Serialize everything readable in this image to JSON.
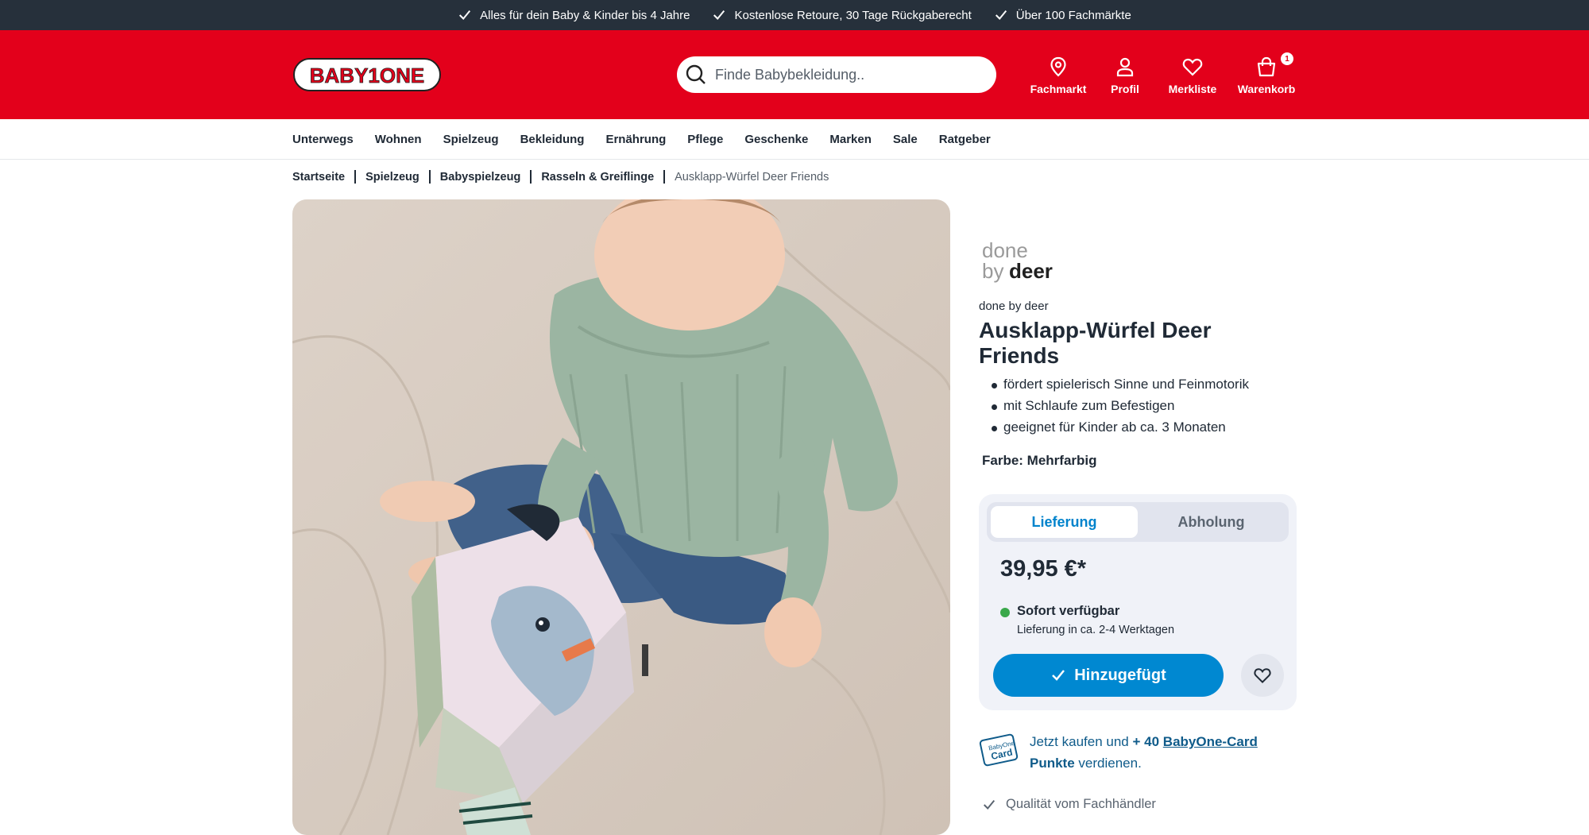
{
  "topbar": {
    "usps": [
      "Alles für dein Baby & Kinder bis 4 Jahre",
      "Kostenlose Retoure, 30 Tage Rückgaberecht",
      "Über 100 Fachmärkte"
    ]
  },
  "header": {
    "logo_text": "BABY1ONE",
    "search_placeholder": "Finde Babybekleidung..",
    "icons": {
      "store": "Fachmarkt",
      "profile": "Profil",
      "wishlist": "Merkliste",
      "cart": "Warenkorb",
      "cart_count": "1"
    }
  },
  "nav": {
    "items": [
      "Unterwegs",
      "Wohnen",
      "Spielzeug",
      "Bekleidung",
      "Ernährung",
      "Pflege",
      "Geschenke",
      "Marken",
      "Sale",
      "Ratgeber"
    ]
  },
  "breadcrumb": {
    "items": [
      "Startseite",
      "Spielzeug",
      "Babyspielzeug",
      "Rasseln & Greiflinge"
    ],
    "current": "Ausklapp-Würfel Deer Friends"
  },
  "product": {
    "brand_logo_text_1": "done",
    "brand_logo_text_2": "by",
    "brand_logo_text_3": "deer",
    "brand": "done by deer",
    "title": "Ausklapp-Würfel Deer Friends",
    "bullets": [
      "fördert spielerisch Sinne und Feinmotorik",
      "mit Schlaufe zum Befestigen",
      "geeignet für Kinder ab ca. 3 Monaten"
    ],
    "color_label": "Farbe: Mehrfarbig"
  },
  "buybox": {
    "tabs": [
      "Lieferung",
      "Abholung"
    ],
    "active_tab": "Lieferung",
    "price": "39,95 €*",
    "availability": "Sofort verfügbar",
    "delivery_time": "Lieferung in ca. 2-4 Werktagen",
    "add_button": "Hinzugefügt"
  },
  "promo": {
    "card_label_1": "BabyOne",
    "card_label_2": "Card",
    "text_1": "Jetzt kaufen und",
    "points": "+ 40",
    "link": "BabyOne-Card",
    "link_2": "Punkte",
    "text_2": "verdienen."
  },
  "quality": "Qualität vom Fachhändler",
  "colors": {
    "header_red": "#e3001b",
    "topbar_dark": "#26303b",
    "accent_blue": "#0088d1",
    "available_green": "#3aa84b"
  }
}
